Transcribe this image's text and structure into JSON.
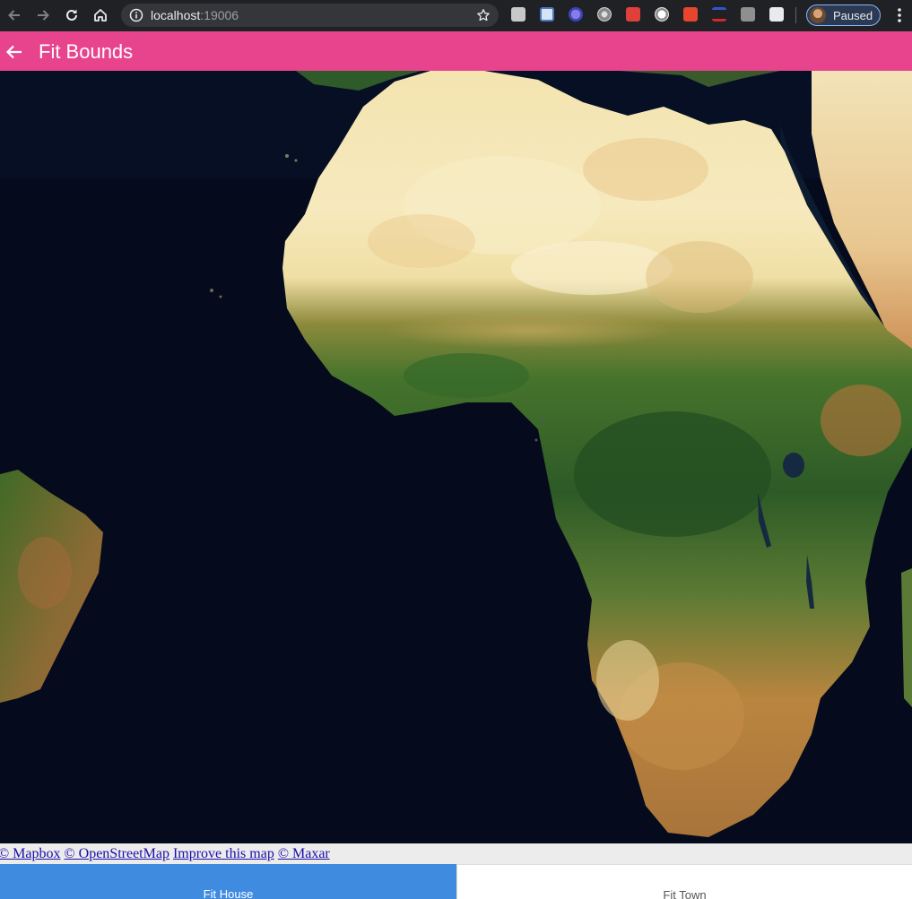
{
  "browser": {
    "url_host": "localhost",
    "url_port": ":19006",
    "profile_status": "Paused",
    "extensions": [
      "t-extension-icon",
      "mail-extension-icon",
      "globe-extension-icon",
      "chrome-extension-icon",
      "puzzle-extension-icon",
      "circle-extension-icon",
      "orange-extension-icon",
      "s-extension-icon",
      "camera-extension-icon",
      "sidebar-extension-icon"
    ]
  },
  "appbar": {
    "title": "Fit Bounds",
    "back_icon": "arrow-left-icon"
  },
  "map": {
    "view": "satellite",
    "region": "Africa and South Atlantic"
  },
  "attribution": {
    "links": [
      "© Mapbox",
      "© OpenStreetMap",
      "Improve this map",
      "© Maxar"
    ]
  },
  "buttons": {
    "fit_house": "Fit House",
    "fit_town": "Fit Town"
  },
  "colors": {
    "appbar": "#e8448e",
    "fit_house_bg": "#3f8be0",
    "fit_town_bg": "#ffffff",
    "ocean": "#04091a"
  }
}
